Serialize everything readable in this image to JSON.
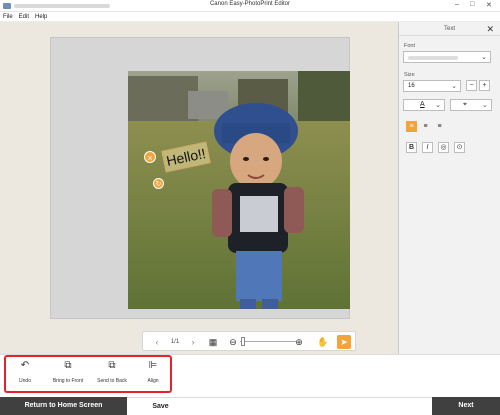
{
  "window": {
    "title": "Canon Easy-PhotoPrint Editor",
    "minimize_icon": "minimize-icon",
    "maximize_icon": "maximize-icon",
    "close_icon": "close-icon"
  },
  "menu": {
    "items": [
      "File",
      "Edit",
      "Help"
    ]
  },
  "canvas": {
    "text_object": "Hello!!",
    "accent_color": "#f2a33a"
  },
  "nav": {
    "page_indicator": "1/1"
  },
  "sidebar": {
    "title": "Text",
    "font_label": "Font",
    "size_label": "Size",
    "size_value": "16",
    "text_color_letter": "A",
    "bold_label": "B",
    "italic_label": "I"
  },
  "actions": [
    {
      "label": "Undo",
      "icon": "undo-icon"
    },
    {
      "label": "Bring to Front",
      "icon": "bring-to-front-icon"
    },
    {
      "label": "Send to Back",
      "icon": "send-to-back-icon"
    },
    {
      "label": "Align",
      "icon": "align-icon"
    }
  ],
  "footer": {
    "home_label": "Return to Home Screen",
    "save_label": "Save",
    "next_label": "Next",
    "dark_color": "#404040"
  }
}
